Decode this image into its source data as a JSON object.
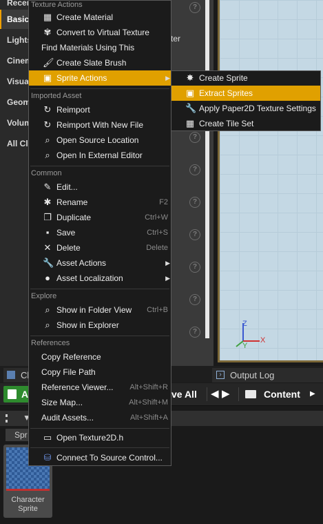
{
  "place_panel": {
    "items": [
      {
        "label": "Recent",
        "selected": false
      },
      {
        "label": "Basic",
        "selected": true
      },
      {
        "label": "Lights",
        "selected": false
      },
      {
        "label": "Cinematic",
        "selected": false
      },
      {
        "label": "Visual Effects",
        "selected": false
      },
      {
        "label": "Geometry",
        "selected": false
      },
      {
        "label": "Volumes",
        "selected": false
      },
      {
        "label": "All Classes",
        "selected": false
      }
    ]
  },
  "details": {
    "partial_text": "ter",
    "help_icon_glyph": "?"
  },
  "viewport": {
    "axis_z": "Z",
    "axis_y": "Y",
    "axis_x": "X"
  },
  "content_browser": {
    "tab_label": "Cl",
    "output_log_tab": "Output Log",
    "add_button": "Ad",
    "save_all": "ve All",
    "path_root": "Content",
    "source_path_label": "Spr",
    "asset": {
      "name_line1": "Character",
      "name_line2": "Sprite"
    }
  },
  "context_menu": {
    "texture_actions": {
      "section": "Texture Actions",
      "items": [
        {
          "label": "Create Material",
          "icon": "material-icon"
        },
        {
          "label": "Convert to Virtual Texture",
          "icon": "virtual-texture-icon"
        },
        {
          "label": "Find Materials Using This",
          "icon": ""
        },
        {
          "label": "Create Slate Brush",
          "icon": "brush-icon"
        },
        {
          "label": "Sprite Actions",
          "icon": "sprite-actions-icon",
          "highlighted": true,
          "submenu": true
        }
      ]
    },
    "imported_asset": {
      "section": "Imported Asset",
      "items": [
        {
          "label": "Reimport",
          "icon": "reimport-icon"
        },
        {
          "label": "Reimport With New File",
          "icon": "reimport-file-icon"
        },
        {
          "label": "Open Source Location",
          "icon": "folder-search-icon"
        },
        {
          "label": "Open In External Editor",
          "icon": "external-editor-icon"
        }
      ]
    },
    "common": {
      "section": "Common",
      "items": [
        {
          "label": "Edit...",
          "icon": "edit-icon",
          "shortcut": ""
        },
        {
          "label": "Rename",
          "icon": "rename-icon",
          "shortcut": "F2"
        },
        {
          "label": "Duplicate",
          "icon": "duplicate-icon",
          "shortcut": "Ctrl+W"
        },
        {
          "label": "Save",
          "icon": "save-icon",
          "shortcut": "Ctrl+S"
        },
        {
          "label": "Delete",
          "icon": "delete-icon",
          "shortcut": "Delete"
        },
        {
          "label": "Asset Actions",
          "icon": "wrench-icon",
          "shortcut": "",
          "submenu": true
        },
        {
          "label": "Asset Localization",
          "icon": "globe-icon",
          "shortcut": "",
          "submenu": true
        }
      ]
    },
    "explore": {
      "section": "Explore",
      "items": [
        {
          "label": "Show in Folder View",
          "icon": "search-folder-icon",
          "shortcut": "Ctrl+B"
        },
        {
          "label": "Show in Explorer",
          "icon": "search-explorer-icon",
          "shortcut": ""
        }
      ]
    },
    "references": {
      "section": "References",
      "items": [
        {
          "label": "Copy Reference",
          "shortcut": ""
        },
        {
          "label": "Copy File Path",
          "shortcut": ""
        },
        {
          "label": "Reference Viewer...",
          "shortcut": "Alt+Shift+R"
        },
        {
          "label": "Size Map...",
          "shortcut": "Alt+Shift+M"
        },
        {
          "label": "Audit Assets...",
          "shortcut": "Alt+Shift+A"
        }
      ]
    },
    "extra": {
      "open_header": "Open Texture2D.h",
      "source_control": "Connect To Source Control..."
    }
  },
  "sprite_submenu": {
    "items": [
      {
        "label": "Create Sprite",
        "icon": "create-sprite-icon",
        "highlighted": false
      },
      {
        "label": "Extract Sprites",
        "icon": "extract-sprites-icon",
        "highlighted": true
      },
      {
        "label": "Apply Paper2D Texture Settings",
        "icon": "apply-settings-icon",
        "highlighted": false
      },
      {
        "label": "Create Tile Set",
        "icon": "tile-set-icon",
        "highlighted": false
      }
    ]
  },
  "colors": {
    "highlight": "#e0a000",
    "menu_bg": "#1b1b1b",
    "add_green": "#2e8b2e"
  }
}
